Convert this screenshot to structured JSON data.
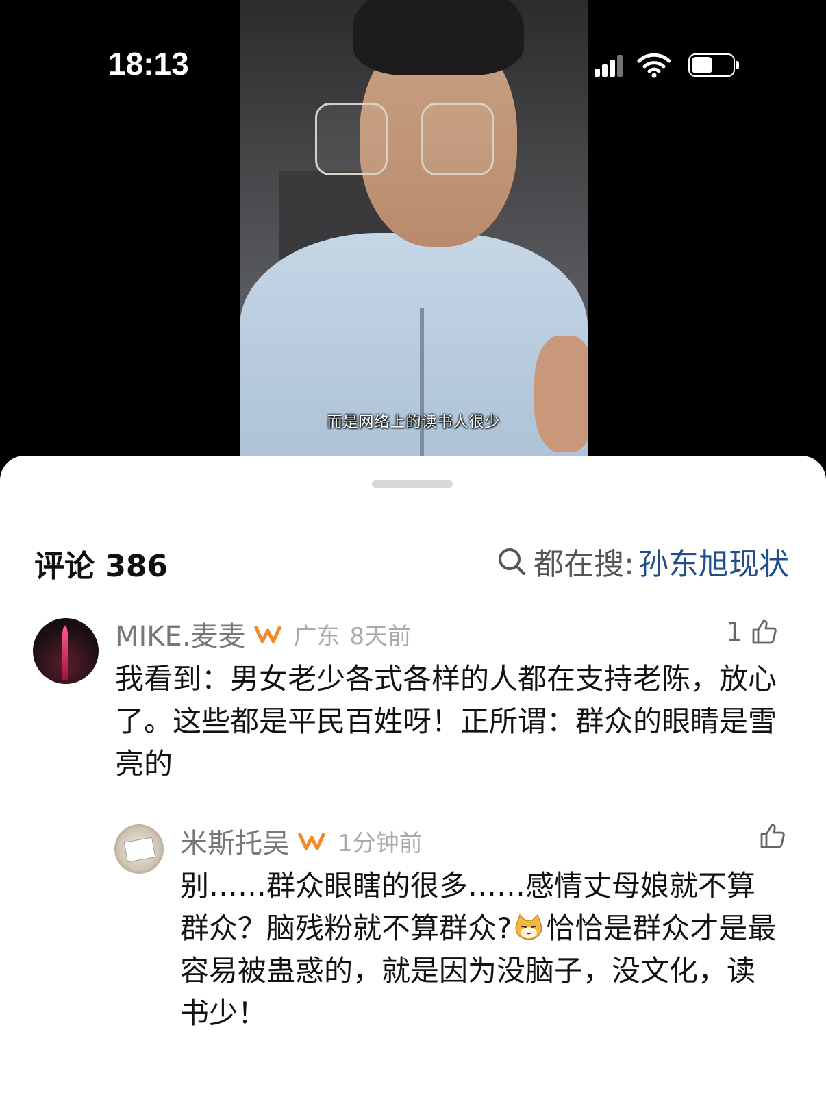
{
  "status_bar": {
    "time": "18:13"
  },
  "video": {
    "subtitle": "而是网络上的读书人很少"
  },
  "header": {
    "comments_label": "评论 386",
    "search_prefix": "都在搜:",
    "search_term": "孙东旭现状"
  },
  "comments": [
    {
      "username": "MIKE.麦麦",
      "location": "广东",
      "time": "8天前",
      "likes": "1",
      "text": "我看到：男女老少各式各样的人都在支持老陈，放心了。这些都是平民百姓呀！正所谓：群众的眼睛是雪亮的"
    },
    {
      "username": "米斯托吴",
      "time": "1分钟前",
      "likes": "",
      "text_part1": "别……群众眼瞎的很多……感情丈母娘就不算群众？脑残粉就不算群众?",
      "text_part2": "恰恰是群众才是最容易被蛊惑的，就是因为没脑子，没文化，读书少！"
    }
  ],
  "colors": {
    "accent_search": "#1f4e8a",
    "badge": "#f08a2a"
  },
  "icons": [
    "signal-icon",
    "wifi-icon",
    "battery-icon",
    "search-icon",
    "badge-icon",
    "thumb-up-icon",
    "cat-emoji-icon"
  ]
}
